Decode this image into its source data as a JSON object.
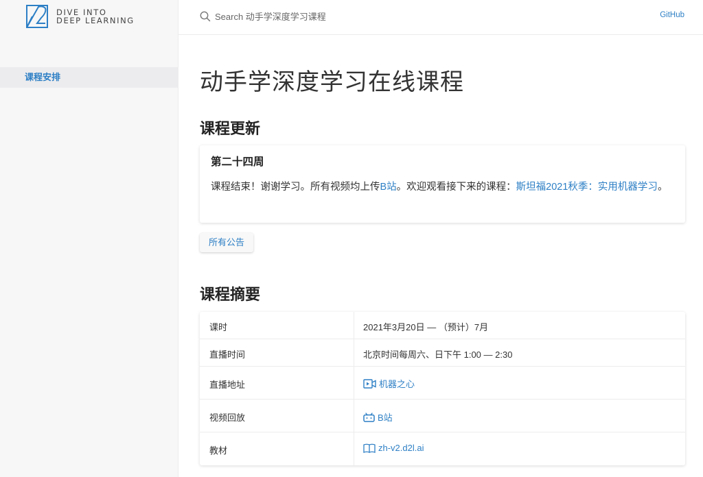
{
  "sidebar": {
    "logo_line1": "DIVE INTO",
    "logo_line2": "DEEP LEARNING",
    "items": [
      {
        "label": "课程安排",
        "active": true
      }
    ]
  },
  "header": {
    "search_placeholder": "Search 动手学深度学习课程",
    "github_label": "GitHub"
  },
  "main": {
    "title": "动手学深度学习在线课程",
    "updates": {
      "heading": "课程更新",
      "week": "第二十四周",
      "text_before": "课程结束！谢谢学习。所有视频均上传",
      "bilibili_link": "B站",
      "text_middle": "。欢迎观看接下来的课程：",
      "stanford_link": "斯坦福2021秋季：实用机器学习",
      "text_after": "。",
      "all_announcements_button": "所有公告"
    },
    "summary": {
      "heading": "课程摘要",
      "rows": [
        {
          "label": "课时",
          "value": "2021年3月20日 — （预计）7月",
          "icon": "",
          "is_link": false
        },
        {
          "label": "直播时间",
          "value": "北京时间每周六、日下午 1:00 — 2:30",
          "icon": "",
          "is_link": false
        },
        {
          "label": "直播地址",
          "value": "机器之心",
          "icon": "video-icon",
          "is_link": true
        },
        {
          "label": "视频回放",
          "value": "B站",
          "icon": "bilibili-icon",
          "is_link": true
        },
        {
          "label": "教材",
          "value": "zh-v2.d2l.ai",
          "icon": "book-icon",
          "is_link": true
        }
      ]
    }
  },
  "colors": {
    "accent": "#2d7fc5",
    "sidebar_bg": "#f7f7f8",
    "sidebar_active_bg": "#ececee",
    "text": "#333333"
  }
}
